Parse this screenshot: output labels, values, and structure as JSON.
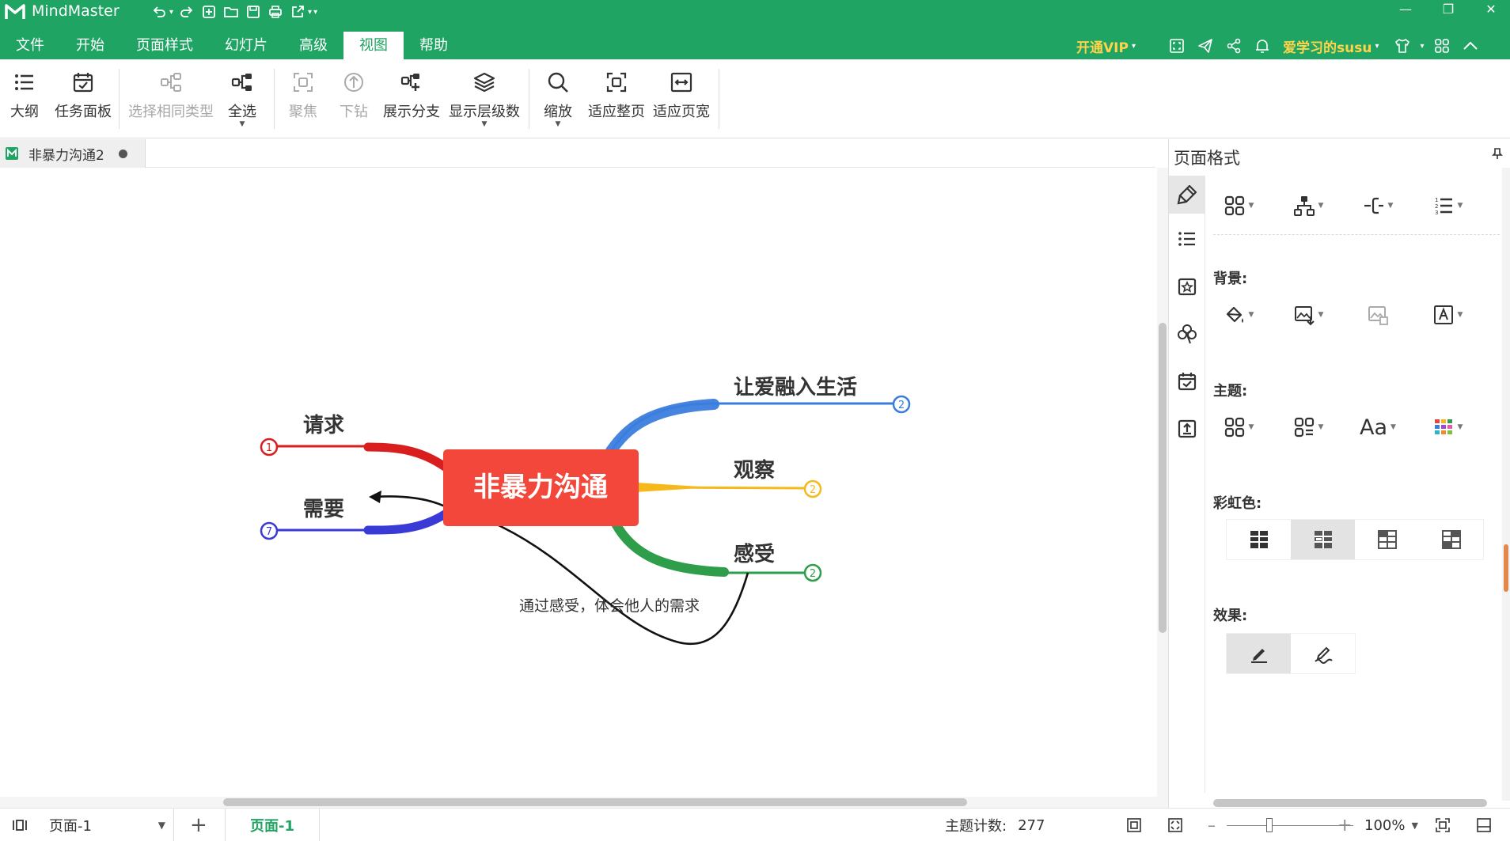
{
  "app": {
    "name": "MindMaster"
  },
  "menu": {
    "items": [
      "文件",
      "开始",
      "页面样式",
      "幻灯片",
      "高级",
      "视图",
      "帮助"
    ],
    "active_index": 5
  },
  "topbar": {
    "vip_label": "开通VIP",
    "user_name": "爱学习的susu"
  },
  "ribbon": {
    "outline": "大纲",
    "task_panel": "任务面板",
    "select_same_type": "选择相同类型",
    "select_all": "全选",
    "focus": "聚焦",
    "drill_down": "下钻",
    "show_branch": "展示分支",
    "show_levels": "显示层级数",
    "zoom": "缩放",
    "fit_page": "适应整页",
    "fit_width": "适应页宽"
  },
  "document": {
    "tab_name": "非暴力沟通2"
  },
  "mindmap": {
    "central": "非暴力沟通",
    "branches": [
      {
        "label": "让爱融入生活",
        "count": "2",
        "color": "#3b7ddd"
      },
      {
        "label": "观察",
        "count": "2",
        "color": "#f5b91c"
      },
      {
        "label": "感受",
        "count": "2",
        "color": "#2e9e4a"
      },
      {
        "label": "请求",
        "count": "1",
        "color": "#d81e1e"
      },
      {
        "label": "需要",
        "count": "7",
        "color": "#3a3ad6"
      }
    ],
    "relationship_label": "通过感受，体会他人的需求",
    "central_color": "#f2473a"
  },
  "panel": {
    "title": "页面格式",
    "background_label": "背景:",
    "theme_label": "主题:",
    "rainbow_label": "彩虹色:",
    "effect_label": "效果:",
    "font_button": "Aa"
  },
  "statusbar": {
    "page_select": "页面-1",
    "page_tab": "页面-1",
    "topic_count_label": "主题计数:",
    "topic_count": "277",
    "zoom": "100%"
  },
  "colors": {
    "brand": "#1fa463",
    "vip": "#ffd34a"
  }
}
